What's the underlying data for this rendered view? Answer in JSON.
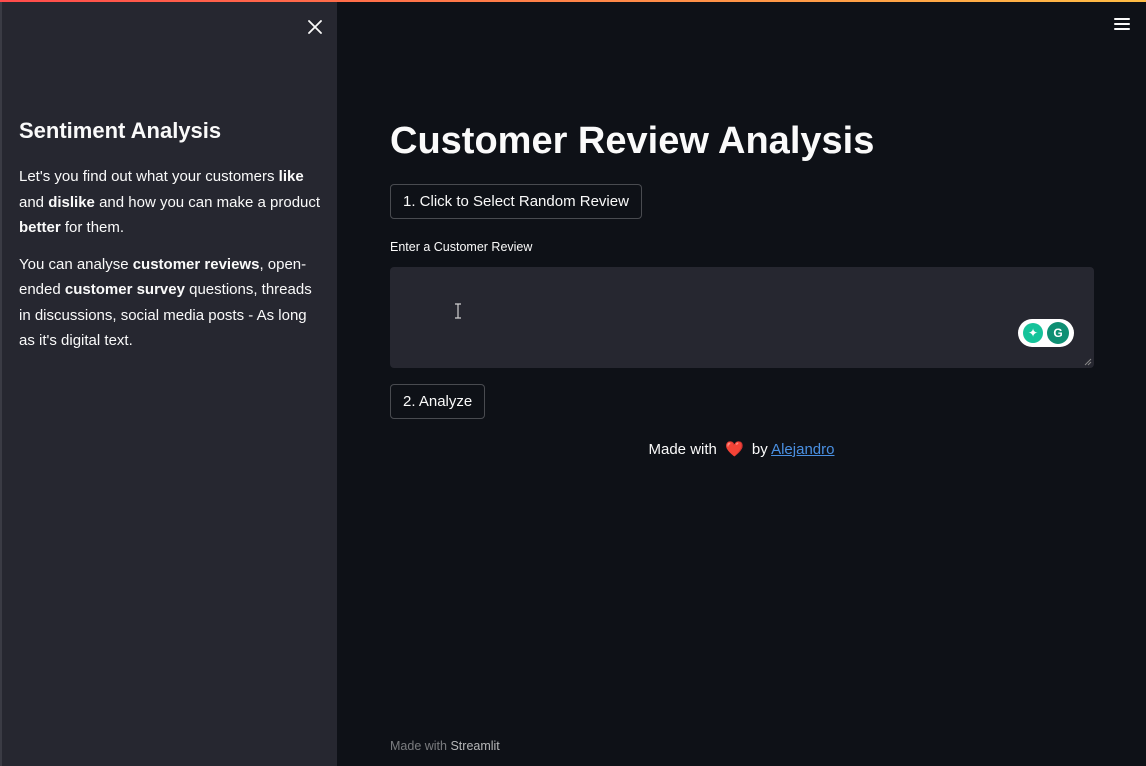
{
  "sidebar": {
    "title": "Sentiment Analysis",
    "p1": {
      "a": "Let's you find out what your customers ",
      "b1": "like",
      "c": " and ",
      "b2": "dislike",
      "d": " and how you can make a product ",
      "b3": "better",
      "e": " for them."
    },
    "p2": {
      "a": "You can analyse ",
      "b1": "customer reviews",
      "c": ", open-ended ",
      "b2": "customer survey",
      "d": " questions, threads in discussions, social media posts - As long as it's digital text."
    }
  },
  "main": {
    "title": "Customer Review Analysis",
    "random_button": "1. Click to Select Random Review",
    "input_label": "Enter a Customer Review",
    "textarea_value": "",
    "analyze_button": "2. Analyze",
    "made_with_prefix": "Made with",
    "heart": "❤️",
    "made_with_by": "by",
    "author_link": "Alejandro"
  },
  "footer": {
    "prefix": "Made with",
    "brand": "Streamlit"
  },
  "icons": {
    "close": "close-icon",
    "menu": "hamburger-menu-icon",
    "grammarly": "grammarly-icon"
  },
  "colors": {
    "background": "#0e1117",
    "sidebar": "#262730",
    "accent": "#ff4b4b",
    "link": "#4a90e2"
  }
}
